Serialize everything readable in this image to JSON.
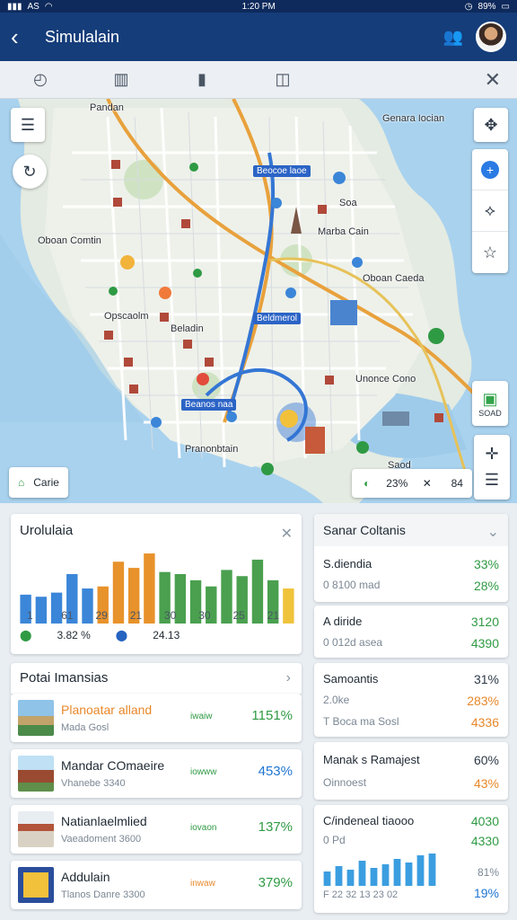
{
  "status": {
    "time": "1:20 PM",
    "left": "AS",
    "battery": "89%"
  },
  "header": {
    "title": "Simulalain"
  },
  "map": {
    "labels": [
      "Pandan",
      "Genara Iocian",
      "Oboan Comtin",
      "Marba Cain",
      "Oboan Caeda",
      "Opscaolm",
      "Beladin",
      "Unonce Cono",
      "Pranonbtain",
      "Soa",
      "Saod"
    ],
    "chips": [
      "Beocoe laoe",
      "Beldmerol",
      "Beanos naa"
    ],
    "scale_label": "SOAD",
    "bottom_left_chip": "Carie",
    "bottom_right": {
      "pct": "23%",
      "val": "84"
    }
  },
  "overview": {
    "title": "Urolulaia",
    "x_ticks": [
      "1",
      "61",
      "29",
      "21",
      "30",
      "30",
      "25",
      "21"
    ],
    "foot_green": "3.82 %",
    "foot_blue": "24.13"
  },
  "chart_data": [
    {
      "type": "bar",
      "title": "Urolulaia",
      "categories": [
        "1",
        "61",
        "29",
        "21",
        "30",
        "30",
        "25",
        "21"
      ],
      "values": [
        28,
        26,
        30,
        48,
        34,
        36,
        60,
        54,
        68,
        50,
        48,
        42,
        36,
        52,
        46,
        62,
        42,
        34
      ],
      "colors": [
        "#3b86d8",
        "#3b86d8",
        "#3b86d8",
        "#3b86d8",
        "#3b86d8",
        "#e8922b",
        "#e8922b",
        "#e8922b",
        "#e8922b",
        "#4aa04f",
        "#4aa04f",
        "#4aa04f",
        "#4aa04f",
        "#4aa04f",
        "#4aa04f",
        "#4aa04f",
        "#4aa04f",
        "#f0c33c"
      ],
      "ylim": [
        0,
        75
      ]
    },
    {
      "type": "bar",
      "values": [
        16,
        22,
        18,
        28,
        20,
        24,
        30,
        26,
        34,
        36
      ],
      "ylim": [
        0,
        40
      ]
    }
  ],
  "places": {
    "title": "Potai Imansias",
    "items": [
      {
        "name": "Planoatar alland",
        "sub": "Mada Gosl",
        "mid": "iwaiw",
        "pct": "1151%",
        "name_color": "#e8882b",
        "mid_color": "#2f9a44",
        "pct_color": "#2f9a44"
      },
      {
        "name": "Mandar COmaeire",
        "sub": "Vhanebe 3340",
        "mid": "iowww",
        "pct": "453%",
        "name_color": "#1f2933",
        "mid_color": "#2f9a44",
        "pct_color": "#1f75d3"
      },
      {
        "name": "Natianlaelmlied",
        "sub": "Vaeadoment 3600",
        "mid": "iovaon",
        "pct": "137%",
        "name_color": "#1f2933",
        "mid_color": "#2f9a44",
        "pct_color": "#2f9a44"
      },
      {
        "name": "Addulain",
        "sub": "Tlanos Danre 3300",
        "mid": "inwaw",
        "pct": "379%",
        "name_color": "#1f2933",
        "mid_color": "#e8882b",
        "pct_color": "#2f9a44"
      }
    ]
  },
  "right": {
    "title": "Sanar Coltanis",
    "r1": {
      "a": "S.diendia",
      "a_val": "33%",
      "b": "0 8100 mad",
      "b_val": "28%"
    },
    "r2": {
      "a": "A diride",
      "a_val": "3120",
      "b": "0 012d asea",
      "b_val": "4390"
    },
    "r3": {
      "a": "Samoantis",
      "a_val": "31%",
      "b": "2.0ke",
      "b_val": "283%",
      "c": "T  Boca ma Sosl",
      "c_val": "4336"
    },
    "r4": {
      "a": "Manak s Ramajest",
      "a_val": "60%",
      "b": "Oinnoest",
      "b_val": "43%"
    },
    "r5": {
      "a": "C/indeneal tiaooo",
      "a_val": "4030",
      "b": "0 Pd",
      "b_val": "4330",
      "c_val": "81%",
      "d_val": "19%",
      "ticks": "F 22 32 13 23 02"
    }
  }
}
